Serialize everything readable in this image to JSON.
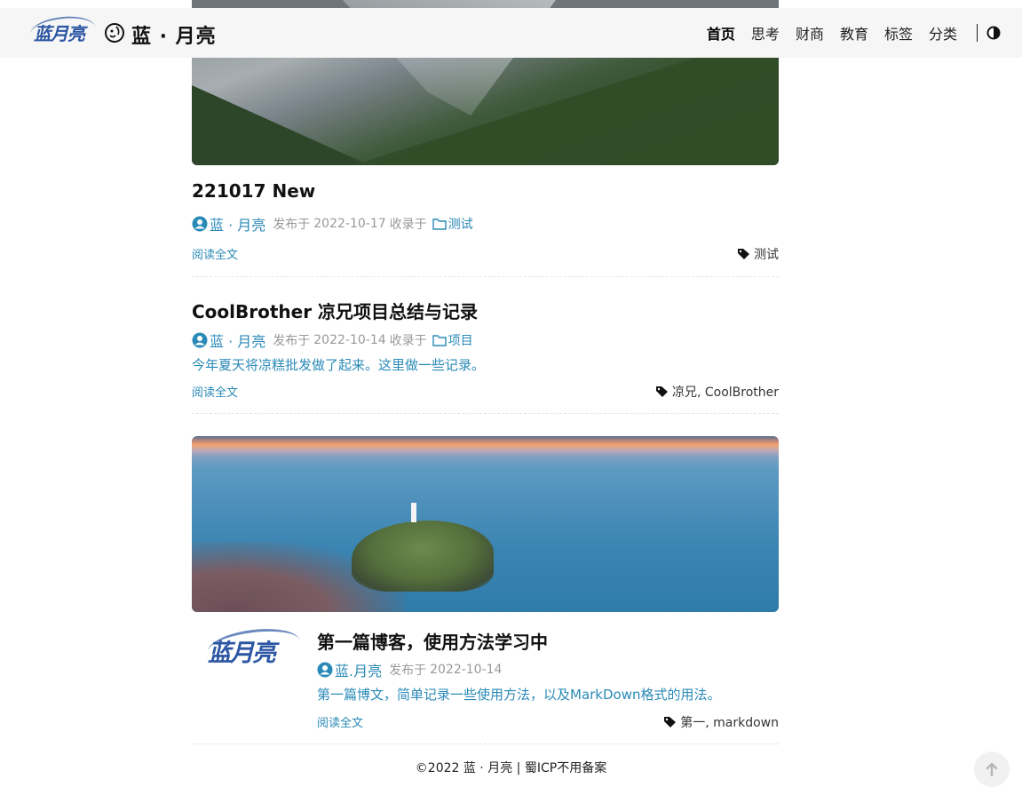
{
  "header": {
    "logo_text": "蓝月亮",
    "site_title": "蓝 · 月亮",
    "nav": [
      {
        "label": "首页",
        "active": true
      },
      {
        "label": "思考",
        "active": false
      },
      {
        "label": "财商",
        "active": false
      },
      {
        "label": "教育",
        "active": false
      },
      {
        "label": "标签",
        "active": false
      },
      {
        "label": "分类",
        "active": false
      }
    ],
    "theme_icon": "half-circle-icon"
  },
  "posts": [
    {
      "title": "221017 New",
      "author": "蓝 · 月亮",
      "published_label": "发布于",
      "date": "2022-10-17",
      "category_label": "收录于",
      "category": "测试",
      "summary": "",
      "read_more": "阅读全文",
      "tags": "测试"
    },
    {
      "title": "CoolBrother 凉兄项目总结与记录",
      "author": "蓝 · 月亮",
      "published_label": "发布于",
      "date": "2022-10-14",
      "category_label": "收录于",
      "category": "项目",
      "summary": "今年夏天将凉糕批发做了起来。这里做一些记录。",
      "read_more": "阅读全文",
      "tags": "凉兄, CoolBrother"
    },
    {
      "title": "第一篇博客，使用方法学习中",
      "author": "蓝.月亮",
      "published_label": "发布于",
      "date": "2022-10-14",
      "summary": "第一篇博文，简单记录一些使用方法，以及MarkDown格式的用法。",
      "read_more": "阅读全文",
      "tags": "第一, markdown",
      "thumb_text": "蓝月亮"
    }
  ],
  "footer": {
    "copyright": "©2022 蓝 · 月亮",
    "separator": "|",
    "icp": "蜀ICP不用备案"
  },
  "colors": {
    "accent": "#2a8ab7",
    "brand": "#2c56a3",
    "header_bg": "#f6f6f6"
  }
}
